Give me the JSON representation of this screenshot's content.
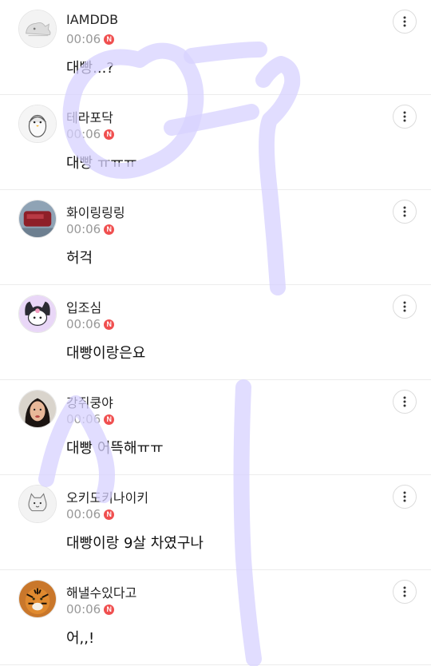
{
  "comments": [
    {
      "nickname": "IAMDDB",
      "time": "00:06",
      "badge": "N",
      "text": "대빵...?",
      "avatar": "dino-icon"
    },
    {
      "nickname": "테라포닥",
      "time": "00:06",
      "badge": "N",
      "text": "대빵 ㅠㅠㅠ",
      "avatar": "penguin-icon"
    },
    {
      "nickname": "화이링링링",
      "time": "00:06",
      "badge": "N",
      "text": "허걱",
      "avatar": "red-pouch-photo"
    },
    {
      "nickname": "입조심",
      "time": "00:06",
      "badge": "N",
      "text": "대빵이랑은요",
      "avatar": "kuromi-icon"
    },
    {
      "nickname": "강쥐쿵야",
      "time": "00:06",
      "badge": "N",
      "text": "대빵 어뜩해ㅠㅠ",
      "avatar": "woman-portrait-photo"
    },
    {
      "nickname": "오키도키나이키",
      "time": "00:06",
      "badge": "N",
      "text": "대빵이랑 9살 차였구나",
      "avatar": "cat-icon"
    },
    {
      "nickname": "해낼수있다고",
      "time": "00:06",
      "badge": "N",
      "text": "어,,!",
      "avatar": "tiger-photo"
    }
  ],
  "colors": {
    "badge": "#f04f4f",
    "overlay_stroke": "#d7d2ff",
    "divider": "#ececec",
    "time": "#999999"
  }
}
